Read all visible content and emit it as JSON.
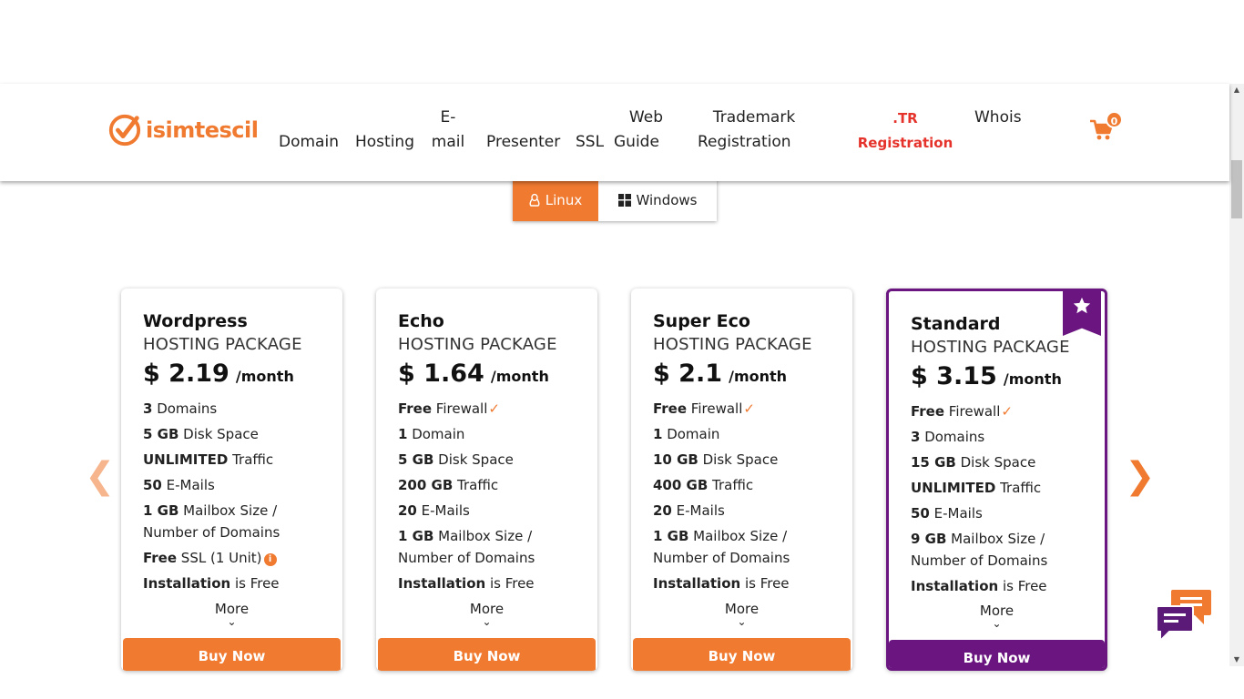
{
  "colors": {
    "accent": "#ef7a30",
    "featured": "#6a1580",
    "tr_red": "#e5322b"
  },
  "header": {
    "logo_text": "isimtescil",
    "nav": {
      "domain": "Domain",
      "hosting": "Hosting",
      "email_1": "E-",
      "email_2": "mail",
      "presenter": "Presenter",
      "ssl": "SSL",
      "webguide_1": "Web",
      "webguide_2": "Guide",
      "trademark_1": "Trademark",
      "trademark_2": "Registration",
      "tr_1": ".TR",
      "tr_2": "Registration",
      "whois": "Whois"
    },
    "cart_icon": "shopping-cart-icon",
    "cart_count": "0"
  },
  "os_tabs": {
    "linux": "Linux",
    "windows": "Windows",
    "linux_icon": "linux-tux-icon",
    "windows_icon": "windows-logo-icon"
  },
  "arrows": {
    "prev": "❮",
    "next": "❯"
  },
  "cards": [
    {
      "name": "Wordpress",
      "subtitle": "HOSTING PACKAGE",
      "price": "$ 2.19",
      "per": "/month",
      "features": [
        {
          "b": "3",
          "t": " Domains"
        },
        {
          "b": "5 GB",
          "t": " Disk Space"
        },
        {
          "b": "UNLIMITED",
          "t": " Traffic"
        },
        {
          "b": "50",
          "t": " E-Mails"
        },
        {
          "b": "1 GB",
          "t": " Mailbox Size /",
          "t2": "Number of Domains"
        },
        {
          "b": "Free",
          "t": " SSL (1 Unit)",
          "info": "i"
        },
        {
          "b": "Installation",
          "t": " is Free"
        }
      ],
      "more": "More",
      "buy": "Buy Now"
    },
    {
      "name": "Echo",
      "subtitle": "HOSTING PACKAGE",
      "price": "$ 1.64",
      "per": "/month",
      "features": [
        {
          "b": "Free",
          "t": " Firewall",
          "check": "✓"
        },
        {
          "b": "1",
          "t": " Domain"
        },
        {
          "b": "5 GB",
          "t": " Disk Space"
        },
        {
          "b": "200 GB",
          "t": " Traffic"
        },
        {
          "b": "20",
          "t": " E-Mails"
        },
        {
          "b": "1 GB",
          "t": " Mailbox Size /",
          "t2": "Number of Domains"
        },
        {
          "b": "Installation",
          "t": " is Free"
        }
      ],
      "more": "More",
      "buy": "Buy Now"
    },
    {
      "name": "Super Eco",
      "subtitle": "HOSTING PACKAGE",
      "price": "$ 2.1",
      "per": "/month",
      "features": [
        {
          "b": "Free",
          "t": " Firewall",
          "check": "✓"
        },
        {
          "b": "1",
          "t": " Domain"
        },
        {
          "b": "10 GB",
          "t": " Disk Space"
        },
        {
          "b": "400 GB",
          "t": " Traffic"
        },
        {
          "b": "20",
          "t": " E-Mails"
        },
        {
          "b": "1 GB",
          "t": " Mailbox Size /",
          "t2": "Number of Domains"
        },
        {
          "b": "Installation",
          "t": " is Free"
        }
      ],
      "more": "More",
      "buy": "Buy Now"
    },
    {
      "name": "Standard",
      "subtitle": "HOSTING PACKAGE",
      "price": "$ 3.15",
      "per": "/month",
      "featured_icon": "star-icon",
      "features": [
        {
          "b": "Free",
          "t": " Firewall",
          "check": "✓"
        },
        {
          "b": "3",
          "t": " Domains"
        },
        {
          "b": "15 GB",
          "t": " Disk Space"
        },
        {
          "b": "UNLIMITED",
          "t": " Traffic"
        },
        {
          "b": "50",
          "t": " E-Mails"
        },
        {
          "b": "9 GB",
          "t": " Mailbox Size /",
          "t2": "Number of Domains"
        },
        {
          "b": "Installation",
          "t": " is Free"
        }
      ],
      "more": "More",
      "buy": "Buy Now"
    }
  ],
  "chat_icon": "live-chat-icon"
}
